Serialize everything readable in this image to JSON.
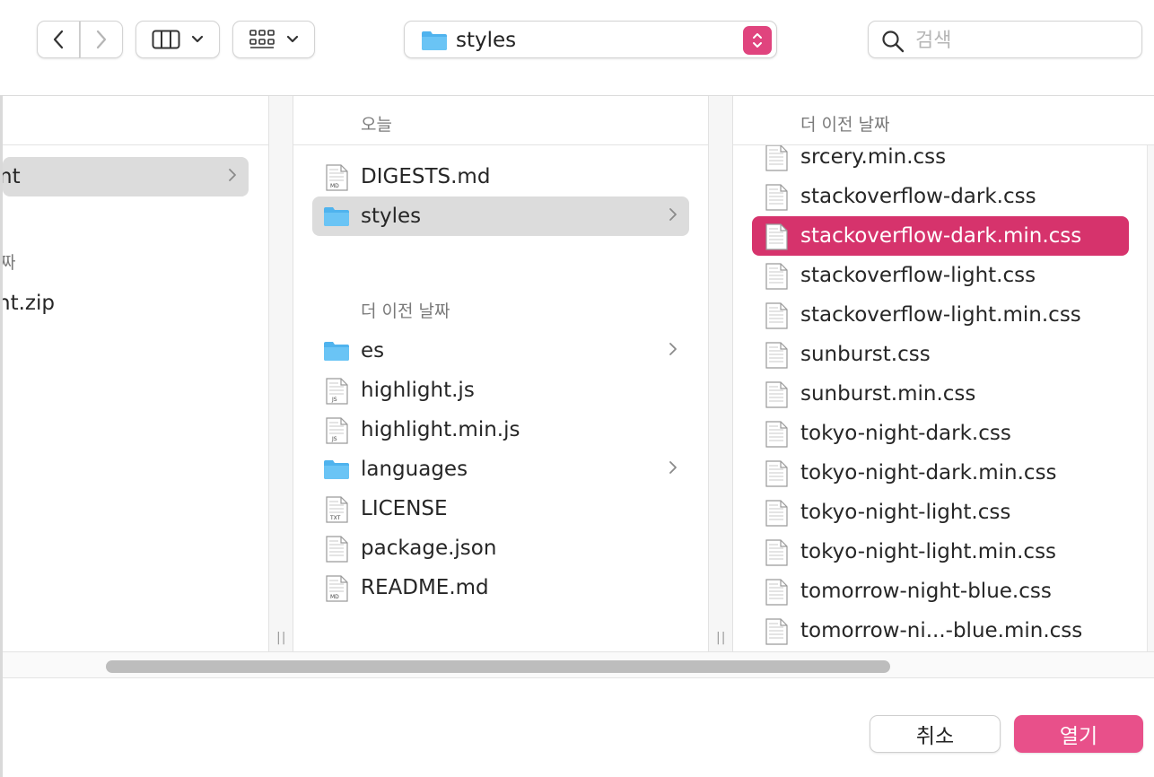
{
  "toolbar": {
    "path_folder": "styles",
    "search_placeholder": "검색"
  },
  "col1": {
    "items": [
      {
        "label": "nt",
        "selected": true
      },
      {
        "label": "짜"
      },
      {
        "label": "nt.zip"
      }
    ]
  },
  "col2": {
    "section_today": "오늘",
    "section_older": "더 이전 날짜",
    "today_items": [
      {
        "label": "DIGESTS.md",
        "icon": "md-file-icon"
      },
      {
        "label": "styles",
        "icon": "folder-icon"
      }
    ],
    "older_items": [
      {
        "label": "es",
        "icon": "folder-icon"
      },
      {
        "label": "highlight.js",
        "icon": "js-file-icon"
      },
      {
        "label": "highlight.min.js",
        "icon": "js-file-icon"
      },
      {
        "label": "languages",
        "icon": "folder-icon"
      },
      {
        "label": "LICENSE",
        "icon": "txt-file-icon"
      },
      {
        "label": "package.json",
        "icon": "json-file-icon"
      },
      {
        "label": "README.md",
        "icon": "md-file-icon"
      }
    ]
  },
  "col3": {
    "section_older": "더 이전 날짜",
    "items": [
      "srcery.min.css",
      "stackoverflow-dark.css",
      "stackoverflow-dark.min.css",
      "stackoverflow-light.css",
      "stackoverflow-light.min.css",
      "sunburst.css",
      "sunburst.min.css",
      "tokyo-night-dark.css",
      "tokyo-night-dark.min.css",
      "tokyo-night-light.css",
      "tokyo-night-light.min.css",
      "tomorrow-night-blue.css",
      "tomorrow-ni...-blue.min.css"
    ],
    "selected_index": 2
  },
  "footer": {
    "cancel_label": "취소",
    "open_label": "열기"
  },
  "colors": {
    "accent": "#d6336c",
    "open_button": "#e8508a",
    "folder_blue": "#4fb3ee"
  }
}
